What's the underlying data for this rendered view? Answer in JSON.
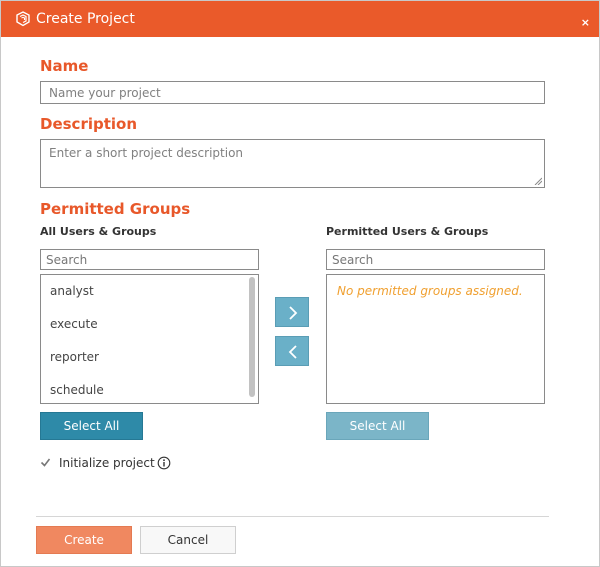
{
  "dialog": {
    "title": "Create Project",
    "close_glyph": "×",
    "logo_icon": "layers-cube-icon",
    "accent_color": "#ea5a2a"
  },
  "name": {
    "heading": "Name",
    "placeholder": "Name your project",
    "value": ""
  },
  "description": {
    "heading": "Description",
    "placeholder": "Enter a short project description",
    "value": ""
  },
  "permitted_groups": {
    "heading": "Permitted Groups",
    "all": {
      "label": "All Users & Groups",
      "search_placeholder": "Search",
      "items": [
        "analyst",
        "execute",
        "reporter",
        "schedule"
      ],
      "select_all_label": "Select All"
    },
    "permitted": {
      "label": "Permitted Users & Groups",
      "search_placeholder": "Search",
      "empty_message": "No permitted groups assigned.",
      "select_all_label": "Select All"
    },
    "add_icon": "chevron-right-icon",
    "remove_icon": "chevron-left-icon"
  },
  "initialize": {
    "label": "Initialize project",
    "checked": true,
    "info_icon": "info-icon"
  },
  "footer": {
    "create_label": "Create",
    "cancel_label": "Cancel"
  }
}
